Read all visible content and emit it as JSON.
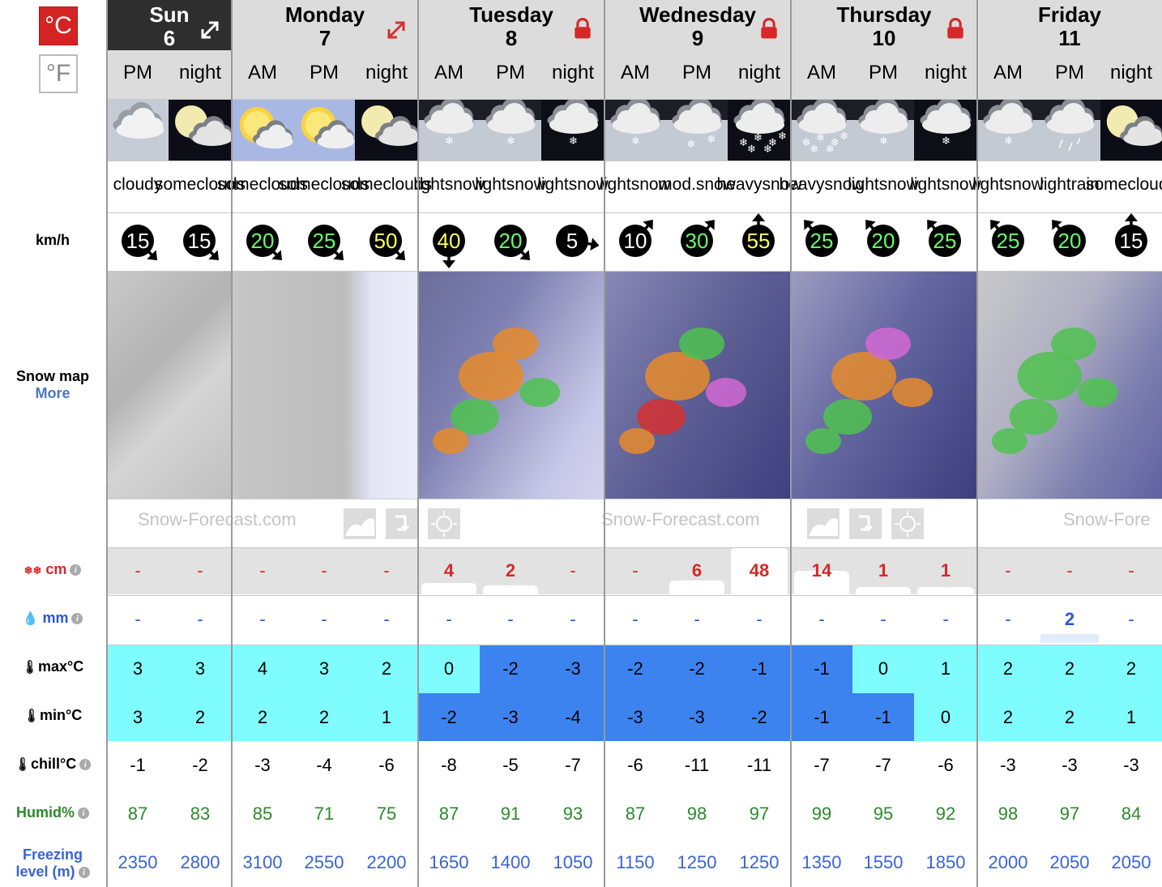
{
  "units": {
    "celsius": "°C",
    "fahrenheit": "°F",
    "active": "celsius"
  },
  "labels": {
    "wind": "km/h",
    "snow_map": "Snow map",
    "more": "More",
    "snow_cm": "cm",
    "rain_mm": "mm",
    "max": "max°C",
    "min": "min°C",
    "chill": "chill°C",
    "humid": "Humid%",
    "freeze_line1": "Freezing",
    "freeze_line2": "level (m)",
    "brand": "Snow-Forecast.com",
    "brand_partial": "Snow-Fore"
  },
  "days": [
    {
      "name": "Sun",
      "num": "6",
      "icon": "expand-icon",
      "periods": 1,
      "dark": true
    },
    {
      "name": "Monday",
      "num": "7",
      "icon": "expand-red-icon",
      "periods": 3
    },
    {
      "name": "Tuesday",
      "num": "8",
      "icon": "lock-icon",
      "periods": 3
    },
    {
      "name": "Wednesday",
      "num": "9",
      "icon": "lock-icon",
      "periods": 3
    },
    {
      "name": "Thursday",
      "num": "10",
      "icon": "lock-icon",
      "periods": 3
    },
    {
      "name": "Friday",
      "num": "11",
      "icon": "",
      "periods": 3
    }
  ],
  "columns": [
    {
      "period": "PM",
      "wx": "cloudy",
      "summary": [
        "cloudy"
      ],
      "wind": 15,
      "dir": "SE",
      "snow": "-",
      "rain": "-",
      "max": "3",
      "min": "3",
      "chill": "-1",
      "humid": "87",
      "freeze": "2350"
    },
    {
      "period": "night",
      "wx": "night-cloud",
      "summary": [
        "some",
        "clouds"
      ],
      "wind": 15,
      "dir": "SE",
      "snow": "-",
      "rain": "-",
      "max": "3",
      "min": "2",
      "chill": "-2",
      "humid": "83",
      "freeze": "2800"
    },
    {
      "period": "AM",
      "wx": "sun-cloud",
      "summary": [
        "some",
        "clouds"
      ],
      "wind": 20,
      "dir": "SE",
      "snow": "-",
      "rain": "-",
      "max": "4",
      "min": "2",
      "chill": "-3",
      "humid": "85",
      "freeze": "3100"
    },
    {
      "period": "PM",
      "wx": "sun-cloud",
      "summary": [
        "some",
        "clouds"
      ],
      "wind": 25,
      "dir": "SE",
      "snow": "-",
      "rain": "-",
      "max": "3",
      "min": "2",
      "chill": "-4",
      "humid": "71",
      "freeze": "2550"
    },
    {
      "period": "night",
      "wx": "night-cloud",
      "summary": [
        "some",
        "clouds"
      ],
      "wind": 50,
      "dir": "SE",
      "snow": "-",
      "rain": "-",
      "max": "2",
      "min": "1",
      "chill": "-6",
      "humid": "75",
      "freeze": "2200"
    },
    {
      "period": "AM",
      "wx": "snow-light",
      "summary": [
        "light",
        "snow"
      ],
      "wind": 40,
      "dir": "S",
      "snow": "4",
      "rain": "-",
      "max": "0",
      "min": "-2",
      "chill": "-8",
      "humid": "87",
      "freeze": "1650"
    },
    {
      "period": "PM",
      "wx": "snow-light",
      "summary": [
        "light",
        "snow"
      ],
      "wind": 20,
      "dir": "SE",
      "snow": "2",
      "rain": "-",
      "max": "-2",
      "min": "-3",
      "chill": "-5",
      "humid": "91",
      "freeze": "1400"
    },
    {
      "period": "night",
      "wx": "snow-light-night",
      "summary": [
        "light",
        "snow"
      ],
      "wind": 5,
      "dir": "E",
      "snow": "-",
      "rain": "-",
      "max": "-3",
      "min": "-4",
      "chill": "-7",
      "humid": "93",
      "freeze": "1050"
    },
    {
      "period": "AM",
      "wx": "snow-light",
      "summary": [
        "light",
        "snow"
      ],
      "wind": 10,
      "dir": "NE",
      "snow": "-",
      "rain": "-",
      "max": "-2",
      "min": "-3",
      "chill": "-6",
      "humid": "87",
      "freeze": "1150"
    },
    {
      "period": "PM",
      "wx": "snow-mod",
      "summary": [
        "mod.",
        "snow"
      ],
      "wind": 30,
      "dir": "NE",
      "snow": "6",
      "rain": "-",
      "max": "-2",
      "min": "-3",
      "chill": "-11",
      "humid": "98",
      "freeze": "1250"
    },
    {
      "period": "night",
      "wx": "snow-heavy-night",
      "summary": [
        "heavy",
        "snow"
      ],
      "wind": 55,
      "dir": "N",
      "snow": "48",
      "rain": "-",
      "max": "-1",
      "min": "-2",
      "chill": "-11",
      "humid": "97",
      "freeze": "1250"
    },
    {
      "period": "AM",
      "wx": "snow-heavy",
      "summary": [
        "heavy",
        "snow"
      ],
      "wind": 25,
      "dir": "NW",
      "snow": "14",
      "rain": "-",
      "max": "-1",
      "min": "-1",
      "chill": "-7",
      "humid": "99",
      "freeze": "1350"
    },
    {
      "period": "PM",
      "wx": "snow-light",
      "summary": [
        "light",
        "snow"
      ],
      "wind": 20,
      "dir": "NW",
      "snow": "1",
      "rain": "-",
      "max": "0",
      "min": "-1",
      "chill": "-7",
      "humid": "95",
      "freeze": "1550"
    },
    {
      "period": "night",
      "wx": "snow-light-night",
      "summary": [
        "light",
        "snow"
      ],
      "wind": 25,
      "dir": "NW",
      "snow": "1",
      "rain": "-",
      "max": "1",
      "min": "0",
      "chill": "-6",
      "humid": "92",
      "freeze": "1850"
    },
    {
      "period": "AM",
      "wx": "snow-light",
      "summary": [
        "light",
        "snow"
      ],
      "wind": 25,
      "dir": "NW",
      "snow": "-",
      "rain": "-",
      "max": "2",
      "min": "2",
      "chill": "-3",
      "humid": "98",
      "freeze": "2000"
    },
    {
      "period": "PM",
      "wx": "rain-light",
      "summary": [
        "light",
        "rain"
      ],
      "wind": 20,
      "dir": "NW",
      "snow": "-",
      "rain": "2",
      "max": "2",
      "min": "2",
      "chill": "-3",
      "humid": "97",
      "freeze": "2050"
    },
    {
      "period": "night",
      "wx": "night-cloud",
      "summary": [
        "some",
        "clouds"
      ],
      "wind": 15,
      "dir": "N",
      "snow": "-",
      "rain": "-",
      "max": "2",
      "min": "1",
      "chill": "-3",
      "humid": "84",
      "freeze": "2050"
    }
  ],
  "colors": {
    "cold": "#3c83f0",
    "mild": "#7ffcfd",
    "snow": "#d62828",
    "rain": "#2a55d8",
    "humid": "#2c8a2c",
    "freeze": "#3a63d8"
  }
}
